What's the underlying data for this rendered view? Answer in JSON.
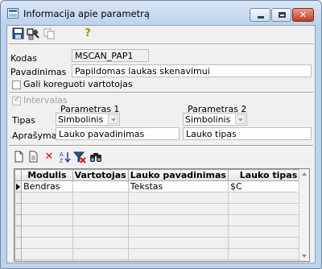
{
  "window": {
    "title": "Informacija apie parametrą",
    "controls": [
      "minimize-icon",
      "maximize-icon",
      "close-icon"
    ]
  },
  "toolbar": {
    "icons": [
      "save-icon",
      "tools-icon",
      "copy-icon",
      "help-icon"
    ],
    "help_glyph": "?"
  },
  "form": {
    "kodas_label": "Kodas",
    "kodas_value": "MSCAN_PAP1",
    "pavadinimas_label": "Pavadinimas",
    "pavadinimas_value": "Papildomas laukas skenavimui",
    "gali_koreguoti_label": "Gali koreguoti vartotojas",
    "gali_koreguoti_checked": false,
    "intervalas_label": "Intervalas",
    "intervalas_checked": true,
    "param1_header": "Parametras 1",
    "param2_header": "Parametras 2",
    "tipas_label": "Tipas",
    "tipas1_value": "Simbolinis",
    "tipas2_value": "Simbolinis",
    "aprasymas_label": "Aprašymas",
    "aprasymas1_value": "Lauko pavadinimas",
    "aprasymas2_value": "Lauko tipas"
  },
  "grid_toolbar": {
    "icons": [
      "new-record-icon",
      "new-document-icon",
      "delete-icon",
      "sort-az-icon",
      "clear-filter-icon",
      "find-icon"
    ],
    "delete_glyph": "✕"
  },
  "grid": {
    "columns": [
      "Modulis",
      "Vartotojas",
      "Lauko pavadinimas",
      "Lauko tipas"
    ],
    "rows": [
      [
        "Bendras",
        "",
        "Tekstas",
        "$C"
      ]
    ]
  },
  "colors": {
    "titlebar": "#bcd3ee",
    "close_button": "#c53a22",
    "client_bg": "#f0f0f0"
  }
}
